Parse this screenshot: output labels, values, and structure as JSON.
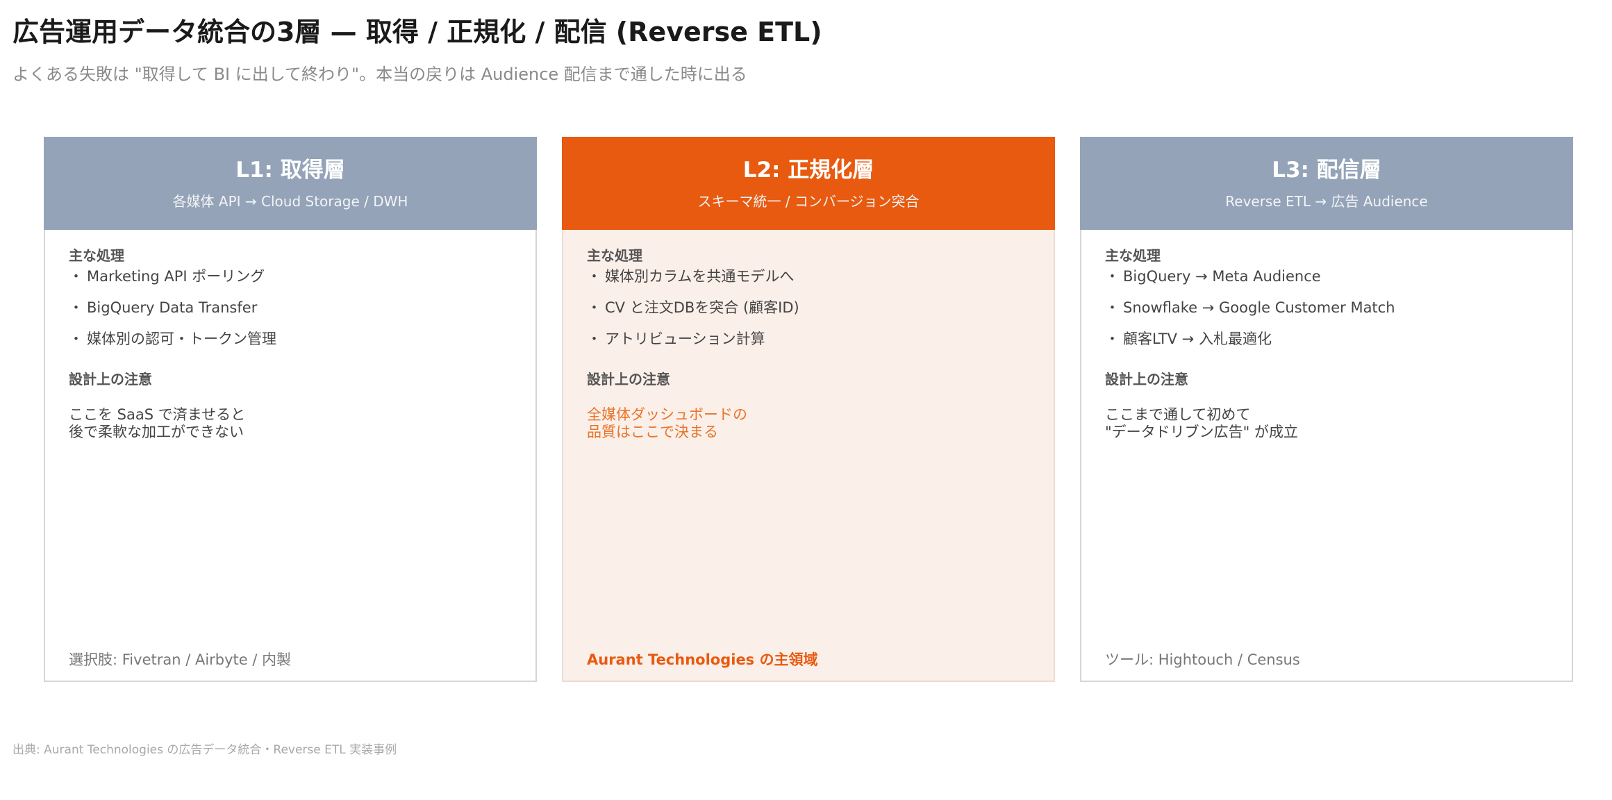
{
  "title": "広告運用データ統合の3層 — 取得 / 正規化 / 配信 (Reverse ETL)",
  "subtitle": "よくある失敗は \"取得して BI に出して終わり\"。本当の戻りは Audience 配信まで通した時に出る",
  "layers": [
    {
      "title": "L1: 取得層",
      "subtitle": "各媒体 API → Cloud Storage / DWH",
      "process_label": "主な処理",
      "bullets": [
        "Marketing API ポーリング",
        "BigQuery Data Transfer",
        "媒体別の認可・トークン管理"
      ],
      "notes_label": "設計上の注意",
      "note": "ここを SaaS で済ませると\n後で柔軟な加工ができない",
      "footer": "選択肢: Fivetran / Airbyte / 内製",
      "header_color": "#94a3b8"
    },
    {
      "title": "L2: 正規化層",
      "subtitle": "スキーマ統一 / コンバージョン突合",
      "process_label": "主な処理",
      "bullets": [
        "媒体別カラムを共通モデルへ",
        "CV と注文DBを突合 (顧客ID)",
        "アトリビューション計算"
      ],
      "notes_label": "設計上の注意",
      "note": "全媒体ダッシュボードの\n品質はここで決まる",
      "footer": "Aurant Technologies の主領域",
      "header_color": "#e85a0f"
    },
    {
      "title": "L3: 配信層",
      "subtitle": "Reverse ETL → 広告 Audience",
      "process_label": "主な処理",
      "bullets": [
        "BigQuery → Meta Audience",
        "Snowflake → Google Customer Match",
        "顧客LTV → 入札最適化"
      ],
      "notes_label": "設計上の注意",
      "note": "ここまで通して初めて\n\"データドリブン広告\" が成立",
      "footer": "ツール: Hightouch / Census",
      "header_color": "#94a3b8"
    }
  ],
  "bullet_glyph": "・",
  "source": "出典: Aurant Technologies の広告データ統合・Reverse ETL 実装事例"
}
